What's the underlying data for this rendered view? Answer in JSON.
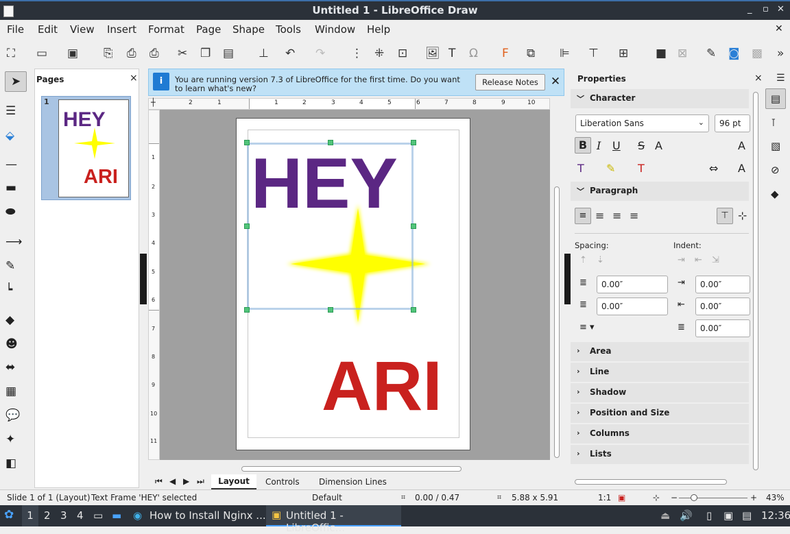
{
  "window": {
    "title": "Untitled 1 - LibreOffice Draw",
    "min": "_",
    "max": "▫",
    "close": "✕"
  },
  "menu": {
    "file": "File",
    "edit": "Edit",
    "view": "View",
    "insert": "Insert",
    "format": "Format",
    "page": "Page",
    "shape": "Shape",
    "tools": "Tools",
    "window": "Window",
    "help": "Help",
    "close": "✕"
  },
  "pages_panel": {
    "title": "Pages",
    "close": "×",
    "page_number": "1",
    "thumb_hey": "HEY",
    "thumb_ari": "ARI"
  },
  "infobar": {
    "message": "You are running version 7.3 of LibreOffice for the first time. Do you want to learn what's new?",
    "button": "Release Notes",
    "close": "✕"
  },
  "ruler": {
    "ticks": [
      "2",
      "1",
      "1",
      "2",
      "3",
      "4",
      "5",
      "6",
      "7",
      "8",
      "9",
      "10"
    ]
  },
  "vruler": {
    "ticks": [
      "1",
      "2",
      "3",
      "4",
      "5",
      "6",
      "7",
      "8",
      "9",
      "10",
      "11"
    ]
  },
  "canvas": {
    "hey": "HEY",
    "ari": "ARI",
    "hey_color": "#5b2783",
    "ari_color": "#c9211e",
    "star_color": "#ffff00"
  },
  "tabs": {
    "layout": "Layout",
    "controls": "Controls",
    "dimension": "Dimension Lines"
  },
  "status": {
    "slide": "Slide 1 of 1 (Layout)",
    "selection": "Text Frame 'HEY' selected",
    "layout": "Default",
    "position": "0.00 / 0.47",
    "size": "5.88 x 5.91",
    "scale": "1:1",
    "zoom": "43%"
  },
  "taskbar": {
    "ws1": "1",
    "ws2": "2",
    "ws3": "3",
    "ws4": "4",
    "task1": "How to Install Nginx ...",
    "task2": "Untitled 1 - LibreOffic...",
    "clock": "12:36"
  },
  "properties": {
    "title": "Properties",
    "close": "×",
    "character": "Character",
    "font": "Liberation Sans",
    "size": "96 pt",
    "paragraph": "Paragraph",
    "spacing": "Spacing:",
    "indent": "Indent:",
    "sp_above": "0.00″",
    "sp_below": "0.00″",
    "ind_before": "0.00″",
    "ind_after": "0.00″",
    "ind_first": "0.00″",
    "area": "Area",
    "line": "Line",
    "shadow": "Shadow",
    "possize": "Position and Size",
    "columns": "Columns",
    "lists": "Lists"
  }
}
